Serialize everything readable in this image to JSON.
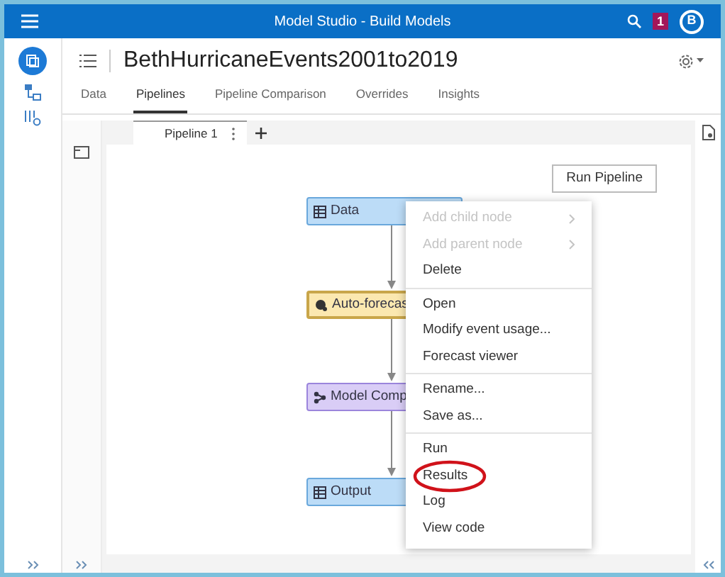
{
  "window": {
    "title": "Model Studio - Build Models",
    "notification_count": "1",
    "avatar": "B"
  },
  "project": {
    "title": "BethHurricaneEvents2001to2019"
  },
  "tabs": [
    {
      "label": "Data",
      "selected": false
    },
    {
      "label": "Pipelines",
      "selected": true
    },
    {
      "label": "Pipeline Comparison",
      "selected": false
    },
    {
      "label": "Overrides",
      "selected": false
    },
    {
      "label": "Insights",
      "selected": false
    }
  ],
  "pipeline_tabs": [
    {
      "label": "Pipeline 1",
      "selected": true
    }
  ],
  "run_button": "Run Pipeline",
  "nodes": [
    {
      "label": "Data",
      "kind": "data",
      "selected": false
    },
    {
      "label": "Auto-forecas",
      "kind": "forecast",
      "selected": true
    },
    {
      "label": "Model Comp",
      "kind": "compare",
      "selected": false
    },
    {
      "label": "Output",
      "kind": "output",
      "selected": false
    }
  ],
  "context_menu": [
    [
      {
        "label": "Add child node",
        "disabled": true,
        "submenu": true
      },
      {
        "label": "Add parent node",
        "disabled": true,
        "submenu": true
      },
      {
        "label": "Delete",
        "disabled": false,
        "submenu": false
      }
    ],
    [
      {
        "label": "Open",
        "disabled": false,
        "submenu": false
      },
      {
        "label": "Modify event usage...",
        "disabled": false,
        "submenu": false
      },
      {
        "label": "Forecast viewer",
        "disabled": false,
        "submenu": false
      }
    ],
    [
      {
        "label": "Rename...",
        "disabled": false,
        "submenu": false
      },
      {
        "label": "Save as...",
        "disabled": false,
        "submenu": false
      }
    ],
    [
      {
        "label": "Run",
        "disabled": false,
        "submenu": false
      },
      {
        "label": "Results",
        "disabled": false,
        "submenu": false,
        "highlighted": true
      },
      {
        "label": "Log",
        "disabled": false,
        "submenu": false
      },
      {
        "label": "View code",
        "disabled": false,
        "submenu": false
      }
    ]
  ]
}
